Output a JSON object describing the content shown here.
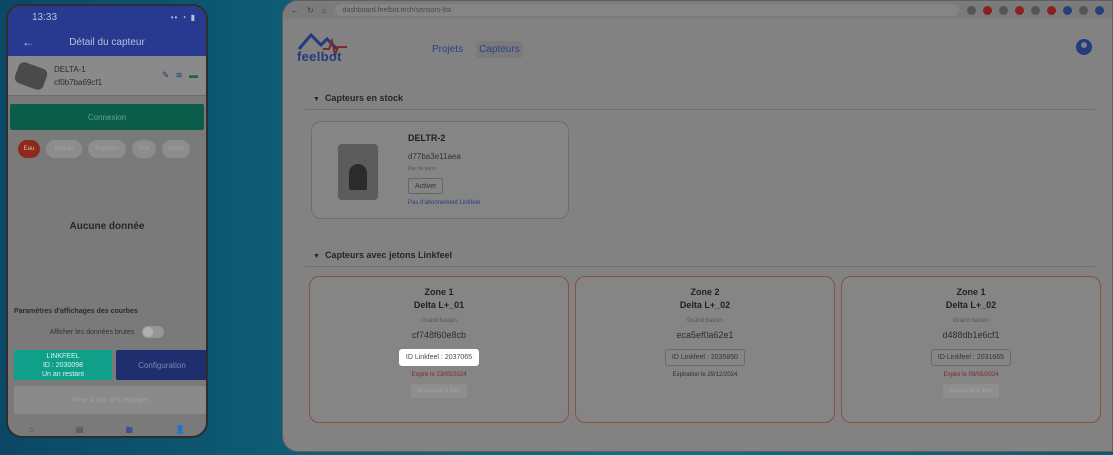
{
  "phone": {
    "status_time": "13:33",
    "status_icons": "•• ◔ ▮",
    "header_title": "Détail du capteur",
    "device_name": "DELTA-1",
    "device_id": "cf0b7ba69cf1",
    "connect_label": "Connexion",
    "chips": [
      "Eau",
      "Niveau",
      "Pression",
      "Flux",
      "Autre"
    ],
    "no_data": "Aucune donnée",
    "params_title": "Paramètres d'affichages des courbes",
    "raw_label": "Afficher les données brutes",
    "linkfeel_lines": [
      "LINKFEEL",
      "ID : 2030098",
      "Un an restant"
    ],
    "config_label": "Configuration",
    "disabled_label": "Mise à jour des réglages",
    "tabs": [
      "⌂",
      "▤",
      "▦",
      "👤"
    ]
  },
  "browser": {
    "url": "dashboard.feelbot.tech/sensors-list",
    "logo_text": "feelbot",
    "nav": [
      "Projets",
      "Capteurs"
    ],
    "stock_section": "Capteurs en stock",
    "stock_card": {
      "name": "DELTR-2",
      "id": "d77ba3e11aea",
      "sub": "Pas de jeton",
      "button": "Activer",
      "link": "Pas d'abonnement Linkfeel"
    },
    "linkfeel_section": "Capteurs avec jetons Linkfeel",
    "zones": [
      {
        "zone": "Zone 1",
        "device": "Delta L+_01",
        "basin": "Grand bassin",
        "hash": "cf748f60e8cb",
        "linkfeel": "ID Linkfeel : 2037065",
        "expiry": "Expire le 23/05/2024",
        "action": "Renouveler le jeton"
      },
      {
        "zone": "Zone 2",
        "device": "Delta L+_02",
        "basin": "Grand bassin",
        "hash": "eca5ef0a62e1",
        "linkfeel": "ID Linkfeel : 2035850",
        "expiry": "Expiration le 29/12/2024",
        "action": ""
      },
      {
        "zone": "Zone 1",
        "device": "Delta L+_02",
        "basin": "Grand bassin",
        "hash": "d488db1e6cf1",
        "linkfeel": "ID Linkfeel : 2031665",
        "expiry": "Expire le 09/05/2024",
        "action": "Renouveler le jeton"
      }
    ]
  },
  "colors": {
    "brand_blue": "#233a7e",
    "linkfeel_teal": "#10a08a",
    "expired_red": "#7a2a2a",
    "card_border_red": "#8a5040"
  }
}
